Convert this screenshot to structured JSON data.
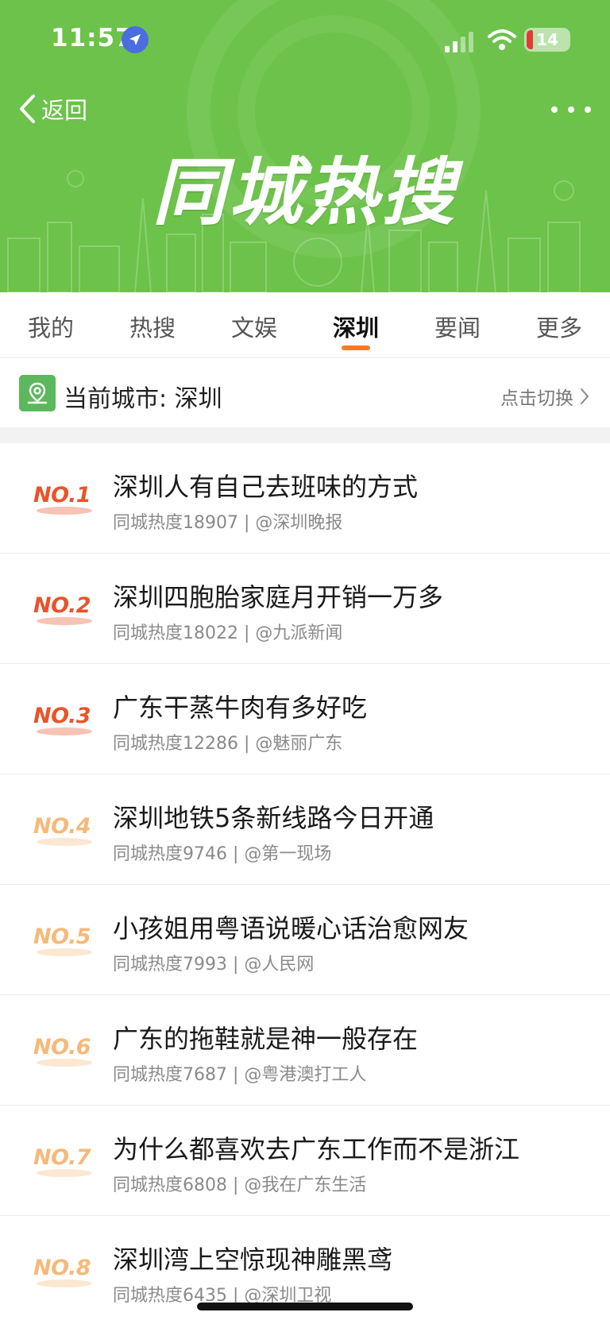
{
  "status_bar": {
    "time": "11:57",
    "battery": "14"
  },
  "nav": {
    "back_label": "返回"
  },
  "banner": {
    "title": "同城热搜"
  },
  "tabs": [
    {
      "label": "我的",
      "active": false
    },
    {
      "label": "热搜",
      "active": false
    },
    {
      "label": "文娱",
      "active": false
    },
    {
      "label": "深圳",
      "active": true
    },
    {
      "label": "要闻",
      "active": false
    },
    {
      "label": "更多",
      "active": false
    }
  ],
  "city": {
    "label": "当前城市: 深圳",
    "switch_label": "点击切换"
  },
  "colors": {
    "header_green": "#6cc24a",
    "accent_orange": "#ff7a21",
    "rank_top": "#e8542b",
    "rank_other": "#f5b97a"
  },
  "items": [
    {
      "rank": "NO.1",
      "title": "深圳人有自己去班味的方式",
      "meta": "同城热度18907 | @深圳晚报"
    },
    {
      "rank": "NO.2",
      "title": "深圳四胞胎家庭月开销一万多",
      "meta": "同城热度18022 | @九派新闻"
    },
    {
      "rank": "NO.3",
      "title": "广东干蒸牛肉有多好吃",
      "meta": "同城热度12286 | @魅丽广东"
    },
    {
      "rank": "NO.4",
      "title": "深圳地铁5条新线路今日开通",
      "meta": "同城热度9746 | @第一现场"
    },
    {
      "rank": "NO.5",
      "title": "小孩姐用粤语说暖心话治愈网友",
      "meta": "同城热度7993 | @人民网"
    },
    {
      "rank": "NO.6",
      "title": "广东的拖鞋就是神一般存在",
      "meta": "同城热度7687 | @粤港澳打工人"
    },
    {
      "rank": "NO.7",
      "title": "为什么都喜欢去广东工作而不是浙江",
      "meta": "同城热度6808 | @我在广东生活"
    },
    {
      "rank": "NO.8",
      "title": "深圳湾上空惊现神雕黑鸢",
      "meta": "同城热度6435 | @深圳卫视"
    }
  ]
}
